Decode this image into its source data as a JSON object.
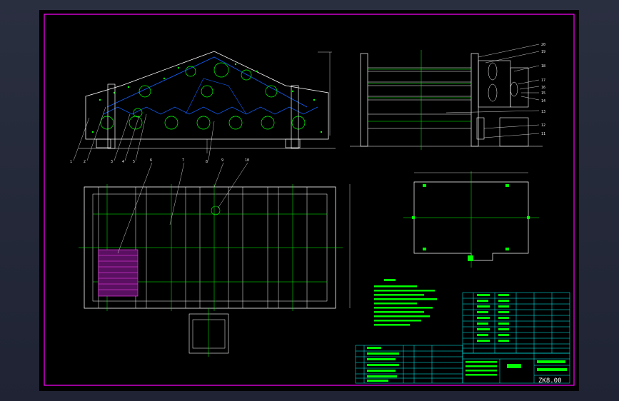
{
  "drawing": {
    "part_labels": [
      "1",
      "2",
      "3",
      "4",
      "5",
      "6",
      "7",
      "8",
      "9",
      "10",
      "11",
      "12",
      "13",
      "14",
      "15",
      "16",
      "17",
      "18",
      "19",
      "20"
    ],
    "drawing_code": "ZK8.00",
    "colors": {
      "frame": "#ff00ff",
      "outline": "#ffffff",
      "centerline": "#00ff00",
      "bolt": "#00ff00",
      "hidden": "#1060ff",
      "mesh": "#ff40ff",
      "table": "#00ffff"
    }
  }
}
